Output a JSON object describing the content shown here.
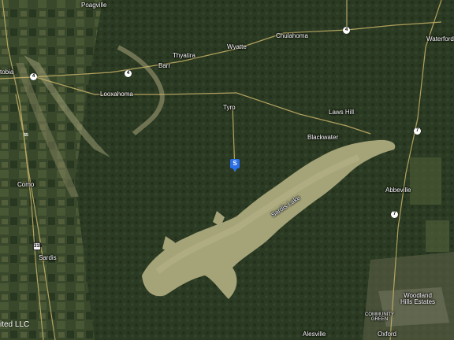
{
  "map": {
    "places": {
      "poagville": "Poagville",
      "chulahoma": "Chulahoma",
      "waterford": "Waterford",
      "wyatte": "Wyatte",
      "thyatira": "Thyatira",
      "barr": "Barr",
      "looxahoma": "Looxahoma",
      "tyro": "Tyro",
      "laws_hill": "Laws Hill",
      "blackwater": "Blackwater",
      "como": "Como",
      "abbeville": "Abbeville",
      "sardis": "Sardis",
      "woodland_hills": "Woodland\nHills Estates",
      "community_green": "COMMUNITY\nGREEN",
      "alesville": "Alesville",
      "oxford": "Oxford",
      "tobia": "tobia"
    },
    "lake_name": "Sardis Lake",
    "routes": {
      "r4_west": "4",
      "r4_mid": "4",
      "r4_east": "4",
      "r7_north": "7",
      "r7_south": "7",
      "i55": "55",
      "r315": "315"
    },
    "marker_label": "S",
    "credit": "ited LLC",
    "colors": {
      "forest": "#2f3d24",
      "lake": "#a5a479",
      "road": "#c9b46a",
      "marker": "#2a6ee8"
    }
  }
}
